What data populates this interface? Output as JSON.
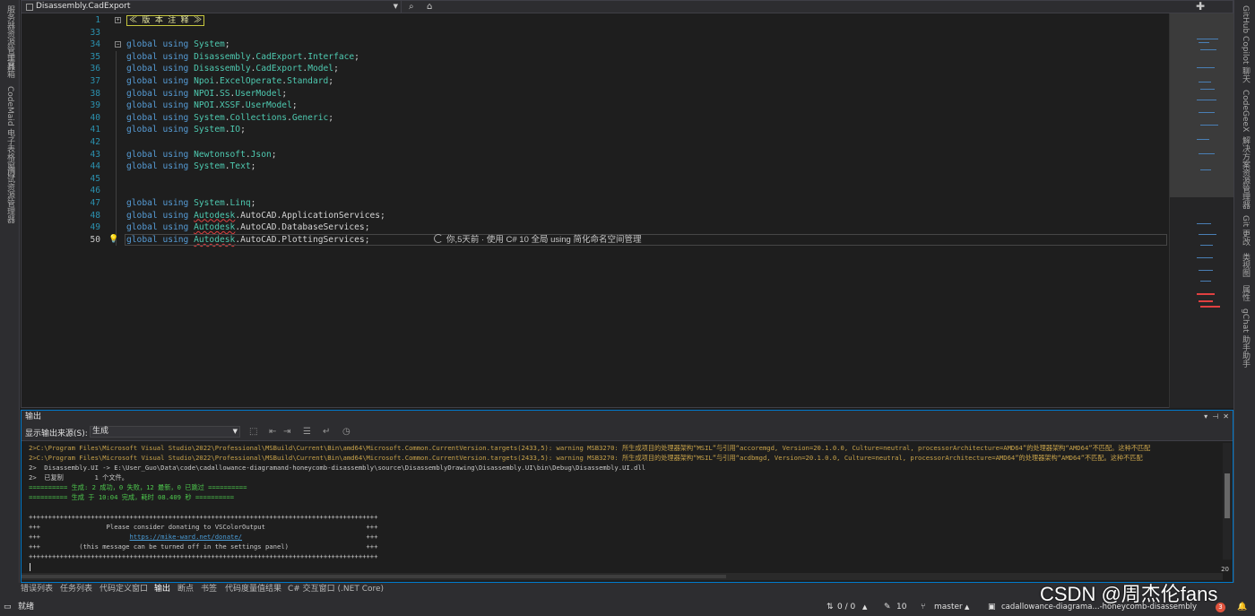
{
  "window": {
    "nav_dropdown": "Disassembly.CadExport",
    "icons": {
      "search": "search-icon",
      "home": "home-icon",
      "plus": "plus-icon"
    }
  },
  "left_rail": [
    "服务器资源管理器",
    "工具箱",
    "CodeMaid 电子表格窗口",
    "测试资源管理器"
  ],
  "right_rail": [
    "GitHub Copilot 聊天",
    "CodeGeeX",
    "解决方案资源管理器",
    "Git 更改",
    "类视图",
    "属性",
    "gChat",
    "助手助手"
  ],
  "editor": {
    "region_label": "≪ 版 本 注 释 ≫",
    "lines": [
      {
        "num": "1",
        "kind": "region"
      },
      {
        "num": "33",
        "kind": "blank"
      },
      {
        "num": "34",
        "kind": "using",
        "parts": [
          {
            "t": "System",
            "c": "ns"
          }
        ],
        "fold": true
      },
      {
        "num": "35",
        "kind": "using",
        "parts": [
          {
            "t": "Disassembly",
            "c": "ns"
          },
          {
            "t": ".",
            "c": "pl"
          },
          {
            "t": "CadExport",
            "c": "ns"
          },
          {
            "t": ".",
            "c": "pl"
          },
          {
            "t": "Interface",
            "c": "ns"
          }
        ]
      },
      {
        "num": "36",
        "kind": "using",
        "parts": [
          {
            "t": "Disassembly",
            "c": "ns"
          },
          {
            "t": ".",
            "c": "pl"
          },
          {
            "t": "CadExport",
            "c": "ns"
          },
          {
            "t": ".",
            "c": "pl"
          },
          {
            "t": "Model",
            "c": "ns"
          }
        ]
      },
      {
        "num": "37",
        "kind": "using",
        "parts": [
          {
            "t": "Npoi",
            "c": "ns"
          },
          {
            "t": ".",
            "c": "pl"
          },
          {
            "t": "ExcelOperate",
            "c": "ns"
          },
          {
            "t": ".",
            "c": "pl"
          },
          {
            "t": "Standard",
            "c": "ns"
          }
        ]
      },
      {
        "num": "38",
        "kind": "using",
        "parts": [
          {
            "t": "NPOI",
            "c": "ns"
          },
          {
            "t": ".",
            "c": "pl"
          },
          {
            "t": "SS",
            "c": "ns"
          },
          {
            "t": ".",
            "c": "pl"
          },
          {
            "t": "UserModel",
            "c": "ns"
          }
        ]
      },
      {
        "num": "39",
        "kind": "using",
        "parts": [
          {
            "t": "NPOI",
            "c": "ns"
          },
          {
            "t": ".",
            "c": "pl"
          },
          {
            "t": "XSSF",
            "c": "ns"
          },
          {
            "t": ".",
            "c": "pl"
          },
          {
            "t": "UserModel",
            "c": "ns"
          }
        ]
      },
      {
        "num": "40",
        "kind": "using",
        "parts": [
          {
            "t": "System",
            "c": "ns"
          },
          {
            "t": ".",
            "c": "pl"
          },
          {
            "t": "Collections",
            "c": "ns"
          },
          {
            "t": ".",
            "c": "pl"
          },
          {
            "t": "Generic",
            "c": "ns"
          }
        ]
      },
      {
        "num": "41",
        "kind": "using",
        "parts": [
          {
            "t": "System",
            "c": "ns"
          },
          {
            "t": ".",
            "c": "pl"
          },
          {
            "t": "IO",
            "c": "ns"
          }
        ]
      },
      {
        "num": "42",
        "kind": "blank"
      },
      {
        "num": "43",
        "kind": "using",
        "parts": [
          {
            "t": "Newtonsoft",
            "c": "ns"
          },
          {
            "t": ".",
            "c": "pl"
          },
          {
            "t": "Json",
            "c": "ns"
          }
        ]
      },
      {
        "num": "44",
        "kind": "using",
        "parts": [
          {
            "t": "System",
            "c": "ns"
          },
          {
            "t": ".",
            "c": "pl"
          },
          {
            "t": "Text",
            "c": "ns"
          }
        ]
      },
      {
        "num": "45",
        "kind": "blank"
      },
      {
        "num": "46",
        "kind": "blank"
      },
      {
        "num": "47",
        "kind": "using",
        "parts": [
          {
            "t": "System",
            "c": "ns"
          },
          {
            "t": ".",
            "c": "pl"
          },
          {
            "t": "Linq",
            "c": "ns"
          }
        ]
      },
      {
        "num": "48",
        "kind": "using",
        "parts": [
          {
            "t": "Autodesk",
            "c": "ns sq"
          },
          {
            "t": ".AutoCAD.ApplicationServices",
            "c": "pl"
          }
        ]
      },
      {
        "num": "49",
        "kind": "using",
        "parts": [
          {
            "t": "Autodesk",
            "c": "ns sq"
          },
          {
            "t": ".AutoCAD.DatabaseServices",
            "c": "pl"
          }
        ]
      },
      {
        "num": "50",
        "kind": "using",
        "parts": [
          {
            "t": "Autodesk",
            "c": "ns sq"
          },
          {
            "t": ".AutoCAD.PlottingServices",
            "c": "pl"
          }
        ],
        "current": true
      }
    ],
    "kw_global": "global",
    "kw_using": "using",
    "semicolon": ";",
    "blame": "你,5天前 · 使用 C# 10 全局 using 简化命名空间管理"
  },
  "output": {
    "title": "输出",
    "source_label": "显示输出来源(S):",
    "source_value": "生成",
    "lines": [
      {
        "t": "2>C:\\Program Files\\Microsoft Visual Studio\\2022\\Professional\\MSBuild\\Current\\Bin\\amd64\\Microsoft.Common.CurrentVersion.targets(2433,5): warning MSB3270: 所生成项目的处理器架构“MSIL”与引用“accoremgd, Version=20.1.0.0, Culture=neutral, processorArchitecture=AMD64”的处理器架构“AMD64”不匹配。这种不匹配",
        "c": "o-warn"
      },
      {
        "t": "2>C:\\Program Files\\Microsoft Visual Studio\\2022\\Professional\\MSBuild\\Current\\Bin\\amd64\\Microsoft.Common.CurrentVersion.targets(2433,5): warning MSB3270: 所生成项目的处理器架构“MSIL”与引用“acdbmgd, Version=20.1.0.0, Culture=neutral, processorArchitecture=AMD64”的处理器架构“AMD64”不匹配。这种不匹配",
        "c": "o-warn"
      },
      {
        "t": "2>  Disassembly.UI -> E:\\User_Guo\\Data\\code\\cadallowance-diagramand-honeycomb-disassembly\\source\\DisassemblyDrawing\\Disassembly.UI\\bin\\Debug\\Disassembly.UI.dll",
        "c": "o-norm"
      },
      {
        "t": "2>  已复制        1 个文件。",
        "c": "o-norm"
      },
      {
        "t": "========== 生成: 2 成功，0 失败，12 最新，0 已跳过 ==========",
        "c": "o-green"
      },
      {
        "t": "========== 生成 于 10:04 完成，耗时 08.409 秒 ==========",
        "c": "o-green"
      },
      {
        "t": "",
        "c": "o-norm"
      },
      {
        "t": "++++++++++++++++++++++++++++++++++++++++++++++++++++++++++++++++++++++++++++++++++++++++++",
        "c": "o-norm"
      },
      {
        "t": "+++                 Please consider donating to VSColorOutput                          +++",
        "c": "o-norm"
      },
      {
        "t": "+++                       https://mike-ward.net/donate/                                +++",
        "c": "o-norm",
        "link": "https://mike-ward.net/donate/"
      },
      {
        "t": "+++          (this message can be turned off in the settings panel)                    +++",
        "c": "o-norm"
      },
      {
        "t": "++++++++++++++++++++++++++++++++++++++++++++++++++++++++++++++++++++++++++++++++++++++++++",
        "c": "o-norm"
      }
    ],
    "zoom": "20"
  },
  "bottom_tabs": [
    "错误列表",
    "任务列表",
    "代码定义窗口",
    "输出",
    "断点",
    "书签",
    "代码度量值结果",
    "C# 交互窗口 (.NET Core)"
  ],
  "status": {
    "ready": "就绪",
    "sync": "0 / 0",
    "edits": "10",
    "branch": "master",
    "repo": "cadallowance-diagrama...-honeycomb-disassembly",
    "notifications": "3"
  },
  "watermark": "CSDN @周杰伦fans"
}
